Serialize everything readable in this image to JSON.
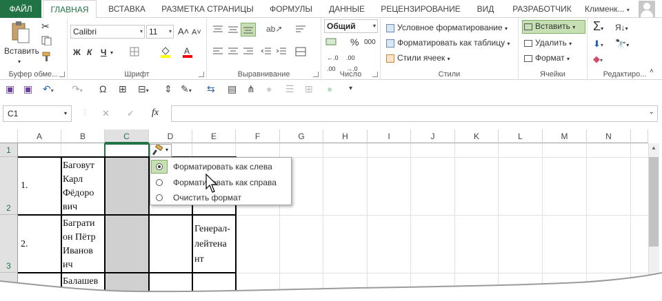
{
  "tabs": [
    "ФАЙЛ",
    "ГЛАВНАЯ",
    "ВСТАВКА",
    "РАЗМЕТКА СТРАНИЦЫ",
    "ФОРМУЛЫ",
    "ДАННЫЕ",
    "РЕЦЕНЗИРОВАНИЕ",
    "ВИД",
    "РАЗРАБОТЧИК"
  ],
  "user": "Клименк...",
  "ribbon": {
    "clipboard": {
      "paste": "Вставить",
      "label": "Буфер обме..."
    },
    "font": {
      "name": "Calibri",
      "size": "11",
      "bold": "Ж",
      "italic": "К",
      "underline": "Ч",
      "label": "Шрифт",
      "grow": "A",
      "shrink": "A"
    },
    "alignment": {
      "label": "Выравнивание"
    },
    "number": {
      "format": "Общий",
      "percent": "%",
      "thousands": "000",
      "label": "Число"
    },
    "styles": {
      "conditional": "Условное форматирование",
      "table": "Форматировать как таблицу",
      "cell_styles": "Стили ячеек",
      "label": "Стили"
    },
    "cells": {
      "insert": "Вставить",
      "delete": "Удалить",
      "format": "Формат",
      "label": "Ячейки"
    },
    "editing": {
      "sum": "Σ",
      "label": "Редактиро..."
    }
  },
  "formula_bar": {
    "name_box": "C1",
    "fx": "fx",
    "cancel": "✕",
    "enter": "✓"
  },
  "columns": [
    "A",
    "B",
    "C",
    "D",
    "E",
    "F",
    "G",
    "H",
    "I",
    "J",
    "K",
    "L",
    "M",
    "N"
  ],
  "rows": [
    "1",
    "2",
    "3"
  ],
  "cells": {
    "a2": "1.",
    "b2": [
      "Баговут",
      "Карл",
      "Фёдоро",
      "вич"
    ],
    "a3": "2.",
    "b3": [
      "Баграти",
      "он Пётр",
      "Иванов",
      "ич"
    ],
    "e3": [
      "Генерал-",
      "лейтена",
      "нт"
    ],
    "b4": "Балашев"
  },
  "menu": {
    "items": [
      "Форматировать как слева",
      "Форматировать как справа",
      "Очистить формат"
    ],
    "checked": 0
  },
  "colors": {
    "accent": "#217346",
    "header_bg": "#e1e1e1",
    "selected_col": "#d0d0d0"
  }
}
